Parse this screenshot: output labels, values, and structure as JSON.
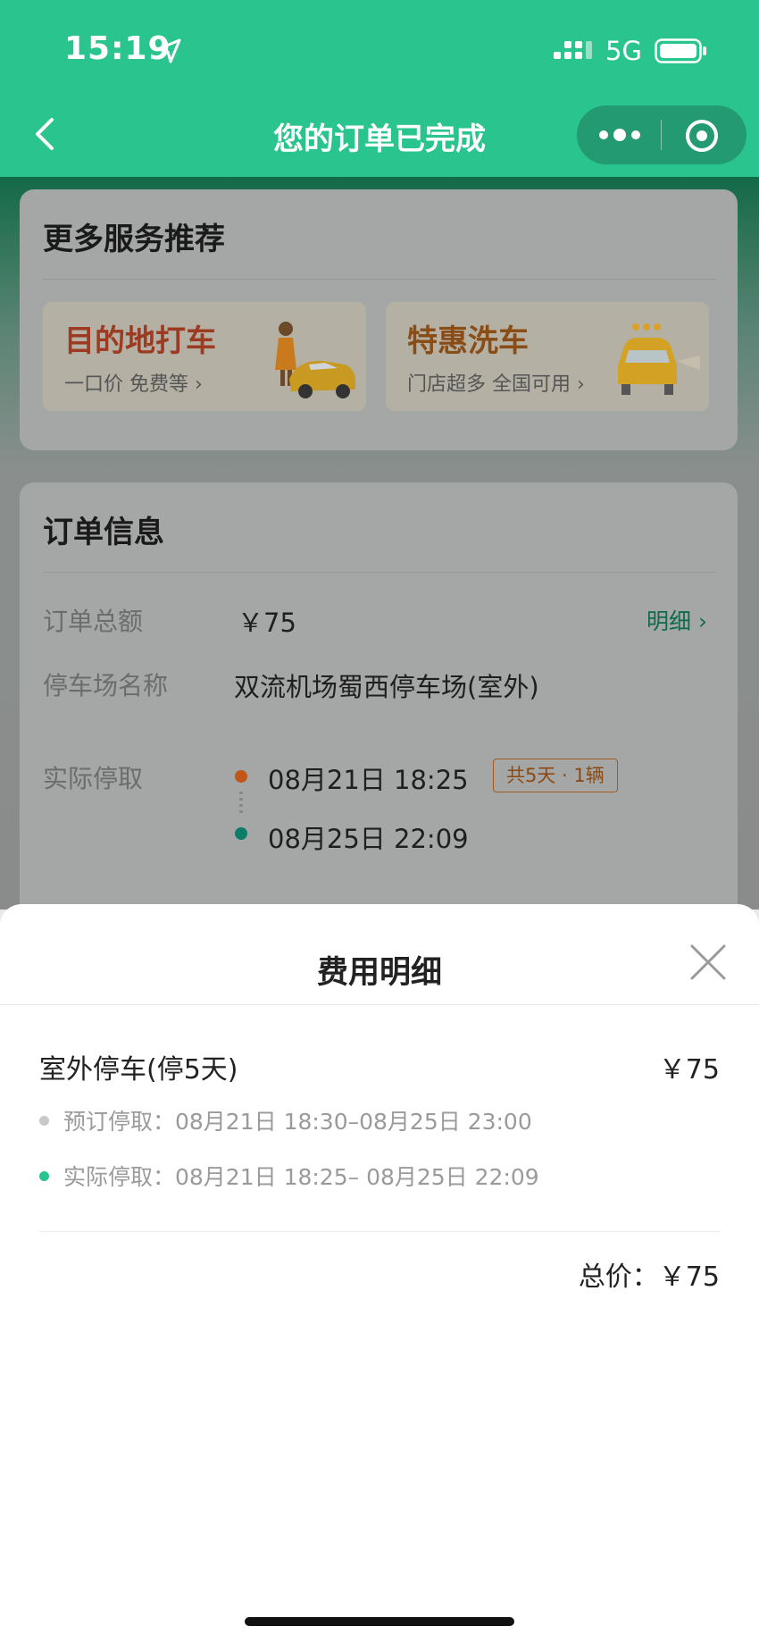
{
  "status_bar": {
    "time": "15:19",
    "network": "5G"
  },
  "nav": {
    "title": "您的订单已完成"
  },
  "services": {
    "title": "更多服务推荐",
    "items": [
      {
        "title": "目的地打车",
        "subtitle": "一口价 免费等 ›"
      },
      {
        "title": "特惠洗车",
        "subtitle": "门店超多 全国可用 ›"
      }
    ]
  },
  "order": {
    "title": "订单信息",
    "total_label": "订单总额",
    "total_value": "￥75",
    "detail_link": "明细 ›",
    "lot_label": "停车场名称",
    "lot_value": "双流机场蜀西停车场(室外)",
    "actual_label": "实际停取",
    "start_time": "08月21日 18:25",
    "end_time": "08月25日 22:09",
    "badge": "共5天 · 1辆"
  },
  "sheet": {
    "title": "费用明细",
    "item_name": "室外停车(停5天)",
    "item_price": "￥75",
    "booked": "预订停取：08月21日 18:30–08月25日 23:00",
    "actual": "实际停取：08月21日 18:25– 08月25日 22:09",
    "total": "总价：￥75"
  },
  "colors": {
    "brand": "#2ac48e",
    "accent_orange": "#c0561a",
    "accent_teal": "#0d7d6a"
  }
}
